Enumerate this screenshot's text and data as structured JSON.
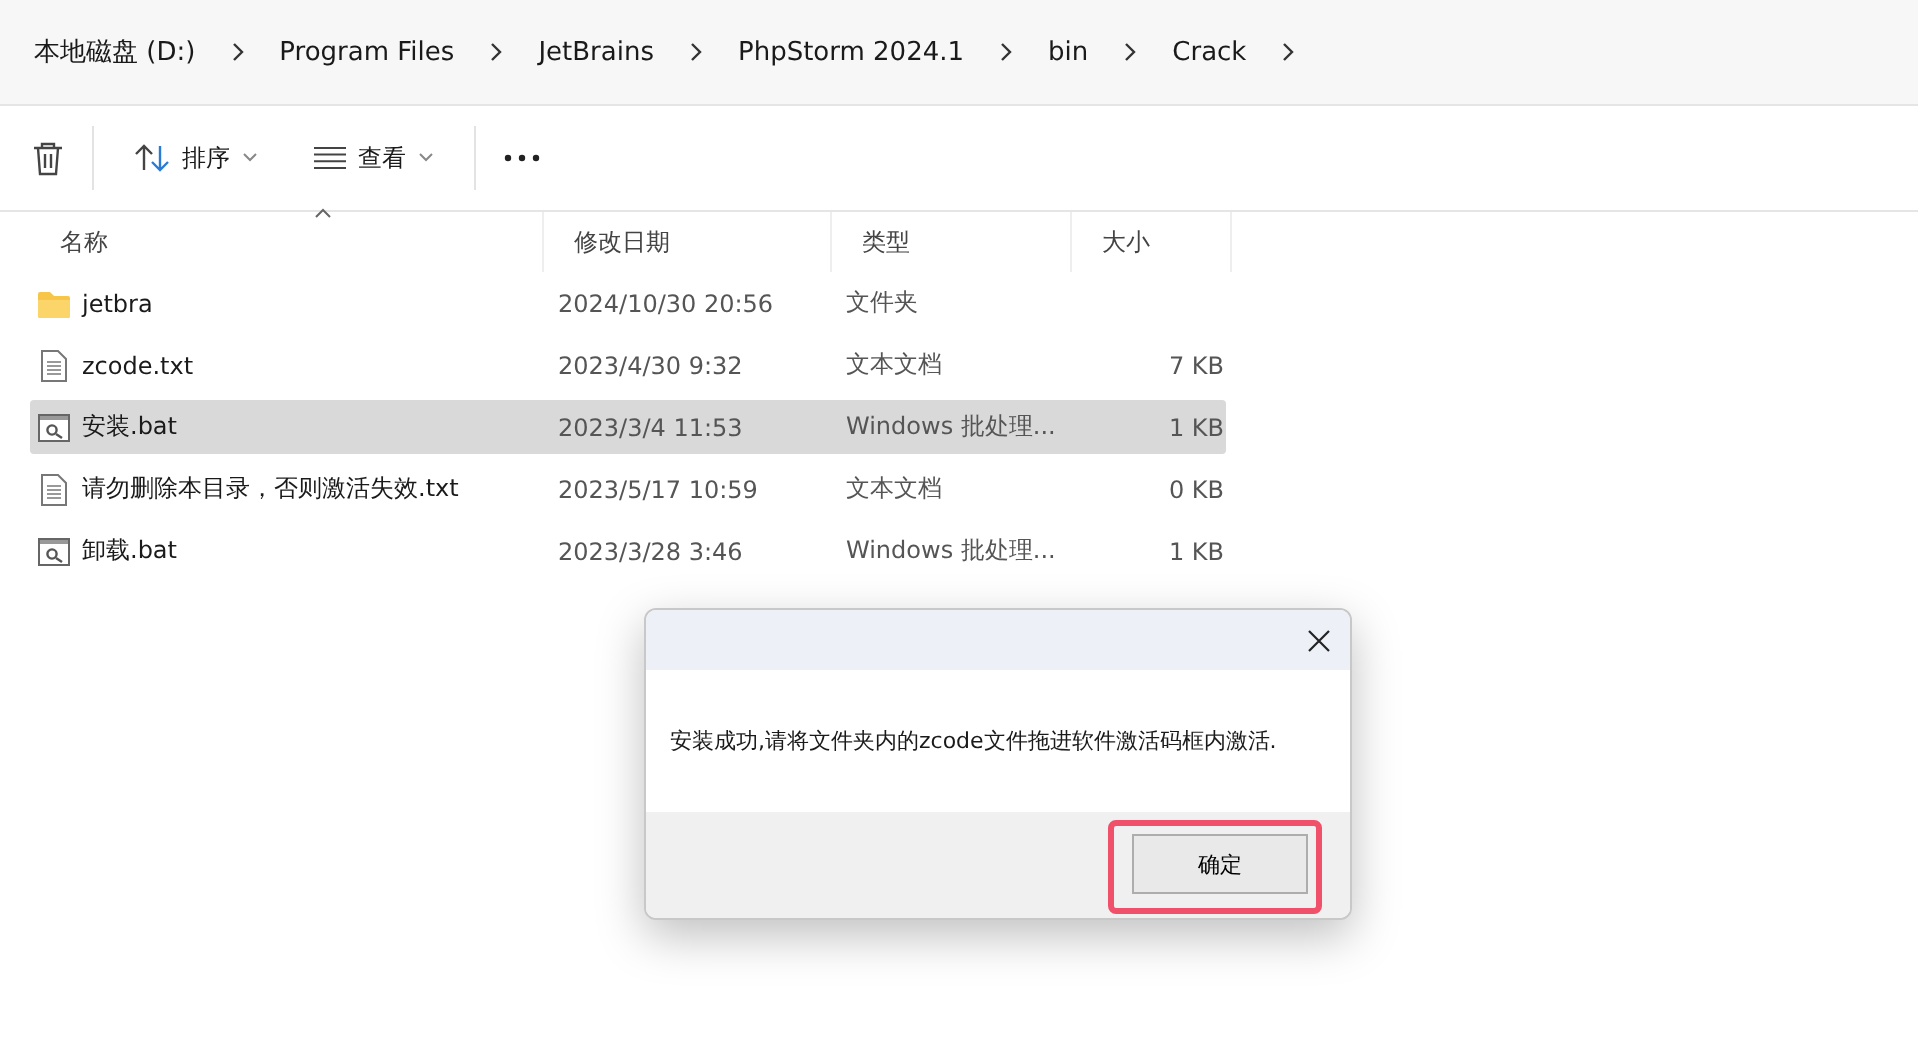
{
  "breadcrumb": [
    "本地磁盘 (D:)",
    "Program Files",
    "JetBrains",
    "PhpStorm 2024.1",
    "bin",
    "Crack"
  ],
  "toolbar": {
    "sort": "排序",
    "view": "查看"
  },
  "table": {
    "columns": [
      "名称",
      "修改日期",
      "类型",
      "大小"
    ],
    "rows": [
      {
        "kind": "folder",
        "name": "jetbra",
        "date": "2024/10/30 20:56",
        "type": "文件夹",
        "selected": false
      },
      {
        "kind": "text",
        "name": "zcode.txt",
        "date": "2023/4/30 9:32",
        "type": "文本文档",
        "size": "7 KB",
        "selected": false
      },
      {
        "kind": "batch",
        "name": "安装.bat",
        "date": "2023/3/4 11:53",
        "type": "Windows 批处理...",
        "size": "1 KB",
        "selected": true
      },
      {
        "kind": "text",
        "name": "请勿删除本目录，否则激活失效.txt",
        "date": "2023/5/17 10:59",
        "type": "文本文档",
        "size": "0 KB",
        "selected": false
      },
      {
        "kind": "batch",
        "name": "卸载.bat",
        "date": "2023/3/28 3:46",
        "type": "Windows 批处理...",
        "size": "1 KB",
        "selected": false
      }
    ]
  },
  "dialog": {
    "message": "安装成功,请将文件夹内的zcode文件拖进软件激活码框内激活.",
    "button": "确定"
  }
}
